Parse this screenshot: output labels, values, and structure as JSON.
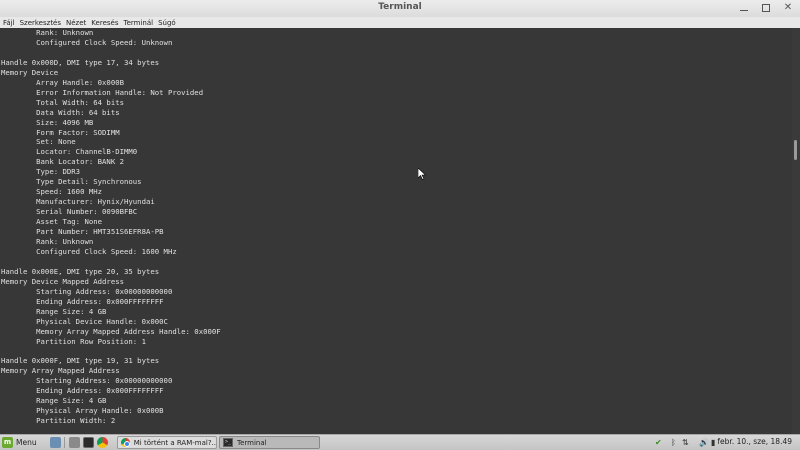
{
  "window": {
    "title": "Terminal"
  },
  "menu": [
    "Fájl",
    "Szerkesztés",
    "Nézet",
    "Keresés",
    "Terminál",
    "Súgó"
  ],
  "terminal_lines": [
    "        Rank: Unknown",
    "        Configured Clock Speed: Unknown",
    "",
    "Handle 0x000D, DMI type 17, 34 bytes",
    "Memory Device",
    "        Array Handle: 0x000B",
    "        Error Information Handle: Not Provided",
    "        Total Width: 64 bits",
    "        Data Width: 64 bits",
    "        Size: 4096 MB",
    "        Form Factor: SODIMM",
    "        Set: None",
    "        Locator: ChannelB-DIMM0",
    "        Bank Locator: BANK 2",
    "        Type: DDR3",
    "        Type Detail: Synchronous",
    "        Speed: 1600 MHz",
    "        Manufacturer: Hynix/Hyundai",
    "        Serial Number: 0090BFBC",
    "        Asset Tag: None",
    "        Part Number: HMT351S6EFR8A-PB",
    "        Rank: Unknown",
    "        Configured Clock Speed: 1600 MHz",
    "",
    "Handle 0x000E, DMI type 20, 35 bytes",
    "Memory Device Mapped Address",
    "        Starting Address: 0x00000000000",
    "        Ending Address: 0x000FFFFFFFF",
    "        Range Size: 4 GB",
    "        Physical Device Handle: 0x000C",
    "        Memory Array Mapped Address Handle: 0x000F",
    "        Partition Row Position: 1",
    "",
    "Handle 0x000F, DMI type 19, 31 bytes",
    "Memory Array Mapped Address",
    "        Starting Address: 0x00000000000",
    "        Ending Address: 0x000FFFFFFFF",
    "        Range Size: 4 GB",
    "        Physical Array Handle: 0x000B",
    "        Partition Width: 2"
  ],
  "taskbar": {
    "menu_label": "Menu",
    "tasks": [
      {
        "label": "Mi történt a RAM-mal?...",
        "icon": "chrome-icon",
        "active": false
      },
      {
        "label": "Terminal",
        "icon": "terminal-icon",
        "active": true
      }
    ],
    "clock": "febr. 10., sze, 18.49"
  },
  "colors": {
    "terminal_bg": "#373737",
    "terminal_fg": "#e0e0e0",
    "mint_green": "#6aaa30"
  }
}
